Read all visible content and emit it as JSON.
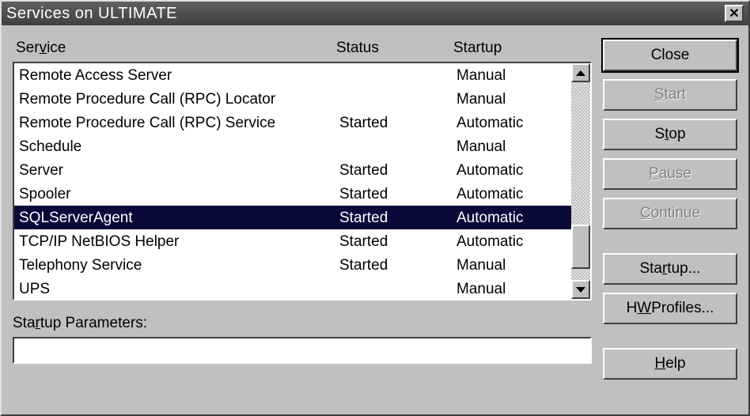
{
  "window": {
    "title": "Services on ULTIMATE"
  },
  "headers": {
    "service_pre": "Ser",
    "service_u": "v",
    "service_post": "ice",
    "status": "Status",
    "startup": "Startup"
  },
  "rows": [
    {
      "service": "Remote Access Server",
      "status": "",
      "startup": "Manual",
      "selected": false
    },
    {
      "service": "Remote Procedure Call (RPC) Locator",
      "status": "",
      "startup": "Manual",
      "selected": false
    },
    {
      "service": "Remote Procedure Call (RPC) Service",
      "status": "Started",
      "startup": "Automatic",
      "selected": false
    },
    {
      "service": "Schedule",
      "status": "",
      "startup": "Manual",
      "selected": false
    },
    {
      "service": "Server",
      "status": "Started",
      "startup": "Automatic",
      "selected": false
    },
    {
      "service": "Spooler",
      "status": "Started",
      "startup": "Automatic",
      "selected": false
    },
    {
      "service": "SQLServerAgent",
      "status": "Started",
      "startup": "Automatic",
      "selected": true
    },
    {
      "service": "TCP/IP NetBIOS Helper",
      "status": "Started",
      "startup": "Automatic",
      "selected": false
    },
    {
      "service": "Telephony Service",
      "status": "Started",
      "startup": "Manual",
      "selected": false
    },
    {
      "service": "UPS",
      "status": "",
      "startup": "Manual",
      "selected": false
    }
  ],
  "params": {
    "label_pre": "Sta",
    "label_u": "r",
    "label_post": "tup Parameters:",
    "value": ""
  },
  "buttons": {
    "close": {
      "pre": "",
      "u": "",
      "post": "Close",
      "disabled": false,
      "default": true
    },
    "start": {
      "pre": "",
      "u": "S",
      "post": "tart",
      "disabled": true,
      "default": false
    },
    "stop": {
      "pre": "S",
      "u": "t",
      "post": "op",
      "disabled": false,
      "default": false
    },
    "pause": {
      "pre": "",
      "u": "P",
      "post": "ause",
      "disabled": true,
      "default": false
    },
    "continue": {
      "pre": "",
      "u": "C",
      "post": "ontinue",
      "disabled": true,
      "default": false
    },
    "startup": {
      "pre": "Sta",
      "u": "r",
      "post": "tup...",
      "disabled": false,
      "default": false
    },
    "hw": {
      "pre": "H",
      "u": "W",
      "post": " Profiles...",
      "disabled": false,
      "default": false
    },
    "help": {
      "pre": "",
      "u": "H",
      "post": "elp",
      "disabled": false,
      "default": false
    }
  }
}
